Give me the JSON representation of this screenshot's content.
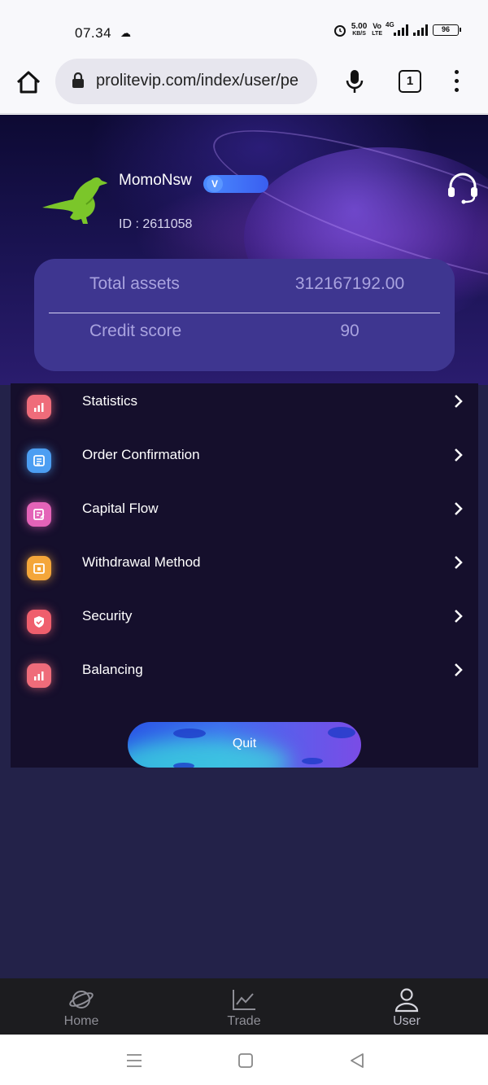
{
  "status_bar": {
    "time": "07.34",
    "network_speed_value": "5.00",
    "network_speed_unit": "KB/S",
    "volte_top": "Vo",
    "volte_bottom": "LTE",
    "network_type": "4G",
    "battery": "96"
  },
  "browser": {
    "url": "prolitevip.com/index/user/pe",
    "tab_count": "1"
  },
  "profile": {
    "username": "MomoNsw",
    "vip_badge": "V",
    "user_id": "ID : 2611058"
  },
  "assets_card": {
    "total_assets_label": "Total assets",
    "total_assets_value": "312167192.00",
    "credit_score_label": "Credit score",
    "credit_score_value": "90"
  },
  "menu": {
    "items": [
      {
        "label": "Statistics",
        "icon": "statistics-icon",
        "color": "#ef6c7a"
      },
      {
        "label": "Order Confirmation",
        "icon": "order-icon",
        "color": "#4c9ef2"
      },
      {
        "label": "Capital Flow",
        "icon": "capital-flow-icon",
        "color": "#e463b8"
      },
      {
        "label": "Withdrawal Method",
        "icon": "wallet-icon",
        "color": "#f4a63a"
      },
      {
        "label": "Security",
        "icon": "shield-icon",
        "color": "#ef5f6d"
      },
      {
        "label": "Balancing",
        "icon": "balancing-icon",
        "color": "#ef6c7a"
      }
    ],
    "quit_label": "Quit"
  },
  "bottom_nav": {
    "items": [
      {
        "label": "Home",
        "icon": "planet-icon"
      },
      {
        "label": "Trade",
        "icon": "chart-line-icon"
      },
      {
        "label": "User",
        "icon": "user-icon"
      }
    ],
    "active": "User"
  },
  "colors": {
    "page_bg": "#232249",
    "card_bg": "#3e3690",
    "menu_bg": "#150f2c",
    "accent": "#3f6df0"
  }
}
